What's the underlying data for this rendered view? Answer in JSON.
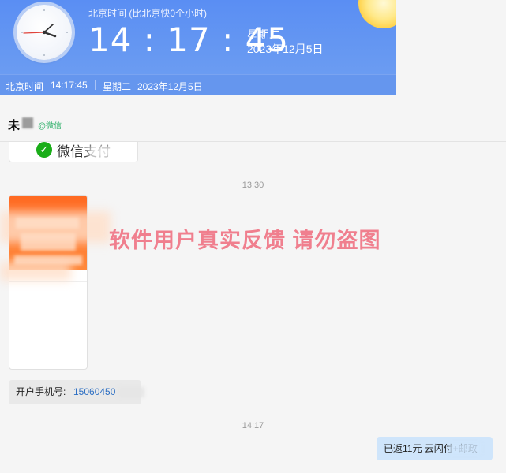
{
  "clock_widget": {
    "timezone_label": "北京时间 (比北京快0个小时)",
    "time": "14 : 17 : 45",
    "weekday": "星期二",
    "date": "2023年12月5日",
    "bar_label": "北京时间",
    "bar_time": "14:17:45",
    "bar_weekday": "星期二",
    "bar_date": "2023年12月5日",
    "colors": {
      "background": "#5b8ff0",
      "bar": "#6596ee"
    }
  },
  "chat": {
    "contact_name": "未",
    "contact_tag": "@微信",
    "wxpay_card_text": "微信支付",
    "timestamps": [
      "13:30",
      "14:17"
    ],
    "watermark": "软件用户真实反馈  请勿盗图",
    "phone_message": {
      "label": "开户手机号:",
      "value": "15060450"
    },
    "reply_message": "已返11元   云闪付+邮政",
    "colors": {
      "watermark": "#f07f8e",
      "reply_bubble": "#cfe5fb",
      "link": "#2d6fc3"
    }
  }
}
